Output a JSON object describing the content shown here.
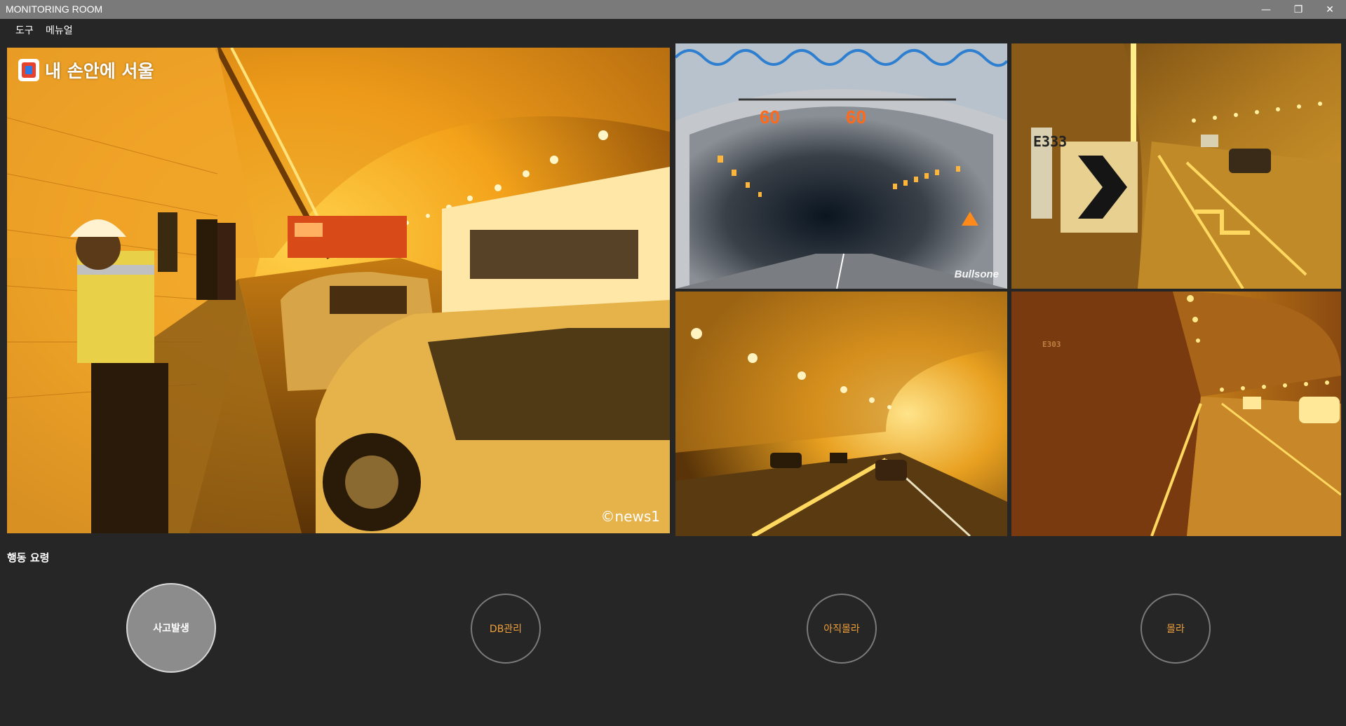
{
  "window": {
    "title": "MONITORING ROOM",
    "controls": {
      "minimize": "—",
      "maximize": "❐",
      "close": "✕"
    }
  },
  "menu": {
    "items": [
      {
        "label": "도구"
      },
      {
        "label": "메뉴얼"
      }
    ]
  },
  "feeds": {
    "main": {
      "logo_text": "내 손안에 서울",
      "watermark": "©news1"
    },
    "cam1": {
      "speed_left": "60",
      "speed_right": "60",
      "brand": "Bullsone"
    },
    "cam2": {
      "sign_code": "E333"
    },
    "cam3": {},
    "cam4": {
      "sign_code": "E303"
    }
  },
  "actions": {
    "section_label": "행동 요령",
    "buttons": [
      {
        "label": "사고발생"
      },
      {
        "label": "DB관리"
      },
      {
        "label": "아직몰라"
      },
      {
        "label": "몰라"
      }
    ]
  },
  "colors": {
    "background": "#262626",
    "titlebar": "#7a7a7a",
    "accent_text": "#f0a03a",
    "primary_button": "#8c8c8c"
  }
}
